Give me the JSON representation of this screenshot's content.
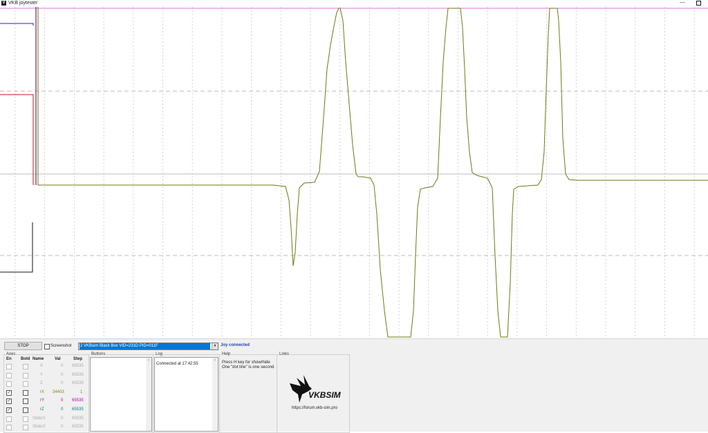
{
  "window": {
    "title": "VKB joytester",
    "app_icon": "V"
  },
  "toolbar": {
    "stop_label": "STOP",
    "screenshot_label": "Screenshot",
    "device_selected": "2 VKBsim Black Box  VID=231D PID=011F",
    "status": "Joy connected",
    "status_color": "#1f3fb0"
  },
  "axes": {
    "title": "Axes",
    "headers": [
      "En",
      "Bold",
      "Name",
      "Val",
      "Step"
    ],
    "rows": [
      {
        "en": false,
        "bold": false,
        "name": "X",
        "val": "0",
        "step": "65535",
        "color": "#aaaaaa",
        "enabled": false
      },
      {
        "en": false,
        "bold": false,
        "name": "Y",
        "val": "0",
        "step": "65535",
        "color": "#aaaaaa",
        "enabled": false
      },
      {
        "en": false,
        "bold": false,
        "name": "Z",
        "val": "0",
        "step": "65535",
        "color": "#aaaaaa",
        "enabled": false
      },
      {
        "en": true,
        "bold": false,
        "name": "rX",
        "val": "34403",
        "step": "1",
        "color": "#7f8a10",
        "enabled": true
      },
      {
        "en": true,
        "bold": false,
        "name": "rY",
        "val": "0",
        "step": "65535",
        "color": "#b000b0",
        "enabled": true
      },
      {
        "en": true,
        "bold": false,
        "name": "rZ",
        "val": "0",
        "step": "65535",
        "color": "#008080",
        "enabled": true
      },
      {
        "en": false,
        "bold": false,
        "name": "Slider1",
        "val": "0",
        "step": "65535",
        "color": "#aaaaaa",
        "enabled": false
      },
      {
        "en": false,
        "bold": false,
        "name": "Slider2",
        "val": "0",
        "step": "65535",
        "color": "#aaaaaa",
        "enabled": false
      }
    ]
  },
  "buttons_group": {
    "title": "Buttons"
  },
  "log": {
    "title": "Log",
    "text": "Connected at 17:42:55"
  },
  "help": {
    "title": "Help",
    "line1": "Press H key for show/hide",
    "line2": "One \"dot line\" is one second"
  },
  "links": {
    "title": "Links",
    "logo_text": "VKBSIM",
    "url": "https://forum.vkb-sim.pro"
  },
  "colors": {
    "trace": "#6b7a12",
    "grid": "#c8c8c8",
    "top_line": "#e070e0"
  }
}
